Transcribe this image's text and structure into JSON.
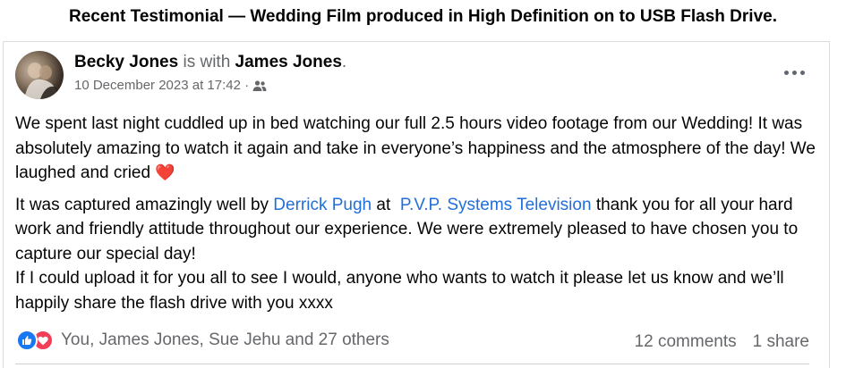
{
  "banner": "Recent Testimonial — Wedding Film produced in High Definition on to USB Flash Drive.",
  "post": {
    "author": "Becky Jones",
    "with_text": "is with",
    "tagged": "James Jones",
    "tagged_suffix": ".",
    "timestamp": "10 December 2023 at 17:42 ·",
    "audience_icon": "friends-icon",
    "more_icon": "more-horizontal-icon",
    "paragraph1": "We spent last night cuddled up in bed watching our full 2.5 hours video footage from our Wedding! It was absolutely amazing to watch it again and take in everyone’s happiness and the atmosphere of the day! We laughed and cried",
    "paragraph1_emoji": "❤️",
    "paragraph2_prefix": "It was captured amazingly well by",
    "mention1": "Derrick Pugh",
    "paragraph2_mid": "at",
    "mention2": "P.V.P. Systems Television",
    "paragraph2_suffix": "thank you for all your hard work and friendly attitude throughout our experience. We were extremely pleased to have chosen you to capture our special day!",
    "paragraph3": "If I could upload it for you all to see I would, anyone who wants to watch it please let us know and we’ll happily share the flash drive with you xxxx"
  },
  "footer": {
    "reaction_icons": [
      "like-icon",
      "love-icon"
    ],
    "reactors": "You, James Jones, Sue Jehu and 27 others",
    "comments": "12 comments",
    "shares": "1 share"
  },
  "colors": {
    "link": "#216fdb",
    "secondary_text": "#65676b",
    "like_blue": "#1877f2",
    "love_red": "#f33e58"
  }
}
